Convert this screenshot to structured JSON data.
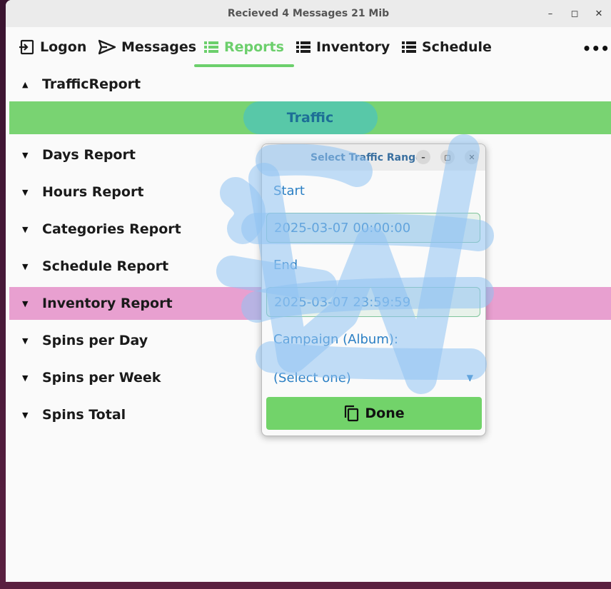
{
  "window": {
    "title": "Recieved 4 Messages  21 Mib",
    "minimize": "–",
    "maximize": "◻",
    "close": "✕"
  },
  "tabs": [
    {
      "label": "Logon",
      "icon": "logon-icon"
    },
    {
      "label": "Messages",
      "icon": "send-icon"
    },
    {
      "label": "Reports",
      "icon": "list-icon"
    },
    {
      "label": "Inventory",
      "icon": "list-icon"
    },
    {
      "label": "Schedule",
      "icon": "list-icon"
    }
  ],
  "more_label": "•••",
  "active_tab": "Reports",
  "reports": {
    "traffic_header": "TrafficReport",
    "traffic_button": "Traffic",
    "items": [
      "Days Report",
      "Hours Report",
      "Categories Report",
      "Schedule Report",
      "Inventory Report",
      "Spins per Day",
      "Spins per Week",
      "Spins Total"
    ]
  },
  "dialog": {
    "title": "Select Traffic Range",
    "min": "–",
    "max": "◻",
    "close": "✕",
    "start_label": "Start",
    "start_value": "2025-03-07 00:00:00",
    "end_label": "End",
    "end_value": "2025-03-07 23:59:59",
    "campaign_label": "Campaign (Album):",
    "campaign_value": "(Select one)",
    "done_label": "Done"
  },
  "colors": {
    "accent": "#6ccf6c",
    "traffic_bar": "#79d372",
    "highlight_row": "#e8a0d0",
    "dialog_text": "#2a7fc4"
  }
}
